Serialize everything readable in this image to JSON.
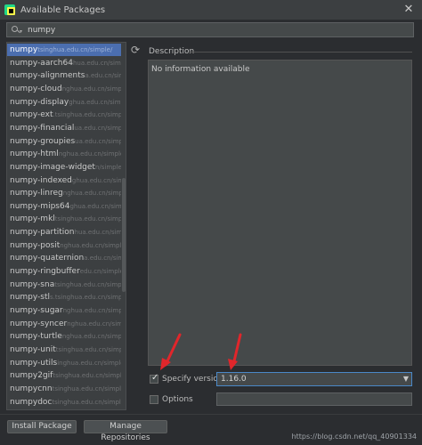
{
  "window": {
    "title": "Available Packages",
    "close_glyph": "✕"
  },
  "search": {
    "value": "numpy",
    "icon": "search-icon"
  },
  "packages": [
    {
      "name": "numpy",
      "repo": "tsinghua.edu.cn/simple/",
      "selected": true
    },
    {
      "name": "numpy-aarch64",
      "repo": "hua.edu.cn/simple/"
    },
    {
      "name": "numpy-alignments",
      "repo": "a.edu.cn/simple/"
    },
    {
      "name": "numpy-cloud",
      "repo": "nghua.edu.cn/simple/"
    },
    {
      "name": "numpy-display",
      "repo": "ghua.edu.cn/simple/"
    },
    {
      "name": "numpy-ext",
      "repo": ".tsinghua.edu.cn/simple/"
    },
    {
      "name": "numpy-financial",
      "repo": "ua.edu.cn/simple/"
    },
    {
      "name": "numpy-groupies",
      "repo": "ua.edu.cn/simple/"
    },
    {
      "name": "numpy-html",
      "repo": "nghua.edu.cn/simple/"
    },
    {
      "name": "numpy-image-widget",
      "repo": "n/simple/"
    },
    {
      "name": "numpy-indexed",
      "repo": "ghua.edu.cn/simple/"
    },
    {
      "name": "numpy-linreg",
      "repo": "nghua.edu.cn/simple/"
    },
    {
      "name": "numpy-mips64",
      "repo": "ghua.edu.cn/simple/"
    },
    {
      "name": "numpy-mkl",
      "repo": "tsinghua.edu.cn/simple/"
    },
    {
      "name": "numpy-partition",
      "repo": "hua.edu.cn/simple/"
    },
    {
      "name": "numpy-posit",
      "repo": "nghua.edu.cn/simple/"
    },
    {
      "name": "numpy-quaternion",
      "repo": "a.edu.cn/simple/"
    },
    {
      "name": "numpy-ringbuffer",
      "repo": "edu.cn/simple/"
    },
    {
      "name": "numpy-sna",
      "repo": "tsinghua.edu.cn/simple/"
    },
    {
      "name": "numpy-stl",
      "repo": "s.tsinghua.edu.cn/simple/"
    },
    {
      "name": "numpy-sugar",
      "repo": "nghua.edu.cn/simple/"
    },
    {
      "name": "numpy-syncer",
      "repo": "nghua.edu.cn/simple/"
    },
    {
      "name": "numpy-turtle",
      "repo": "nghua.edu.cn/simple/"
    },
    {
      "name": "numpy-unit",
      "repo": "tsinghua.edu.cn/simple/"
    },
    {
      "name": "numpy-utils",
      "repo": "inghua.edu.cn/simple/"
    },
    {
      "name": "numpy2gif",
      "repo": "tsinghua.edu.cn/simple/"
    },
    {
      "name": "numpycnn",
      "repo": "tsinghua.edu.cn/simple/"
    },
    {
      "name": "numpydoc",
      "repo": "tsinghua.edu.cn/simple/"
    }
  ],
  "description": {
    "label": "Description",
    "text": "No information available"
  },
  "specify_version": {
    "label": "Specify version",
    "checked": true,
    "value": "1.16.0"
  },
  "options": {
    "label": "Options",
    "checked": false,
    "value": ""
  },
  "buttons": {
    "install": "Install Package",
    "manage": "Manage Repositories"
  },
  "watermark": "https://blog.csdn.net/qq_40901334",
  "colors": {
    "selection": "#4b6eaf",
    "annotation_arrow": "#e0262b",
    "focus_border": "#4a88c7"
  }
}
